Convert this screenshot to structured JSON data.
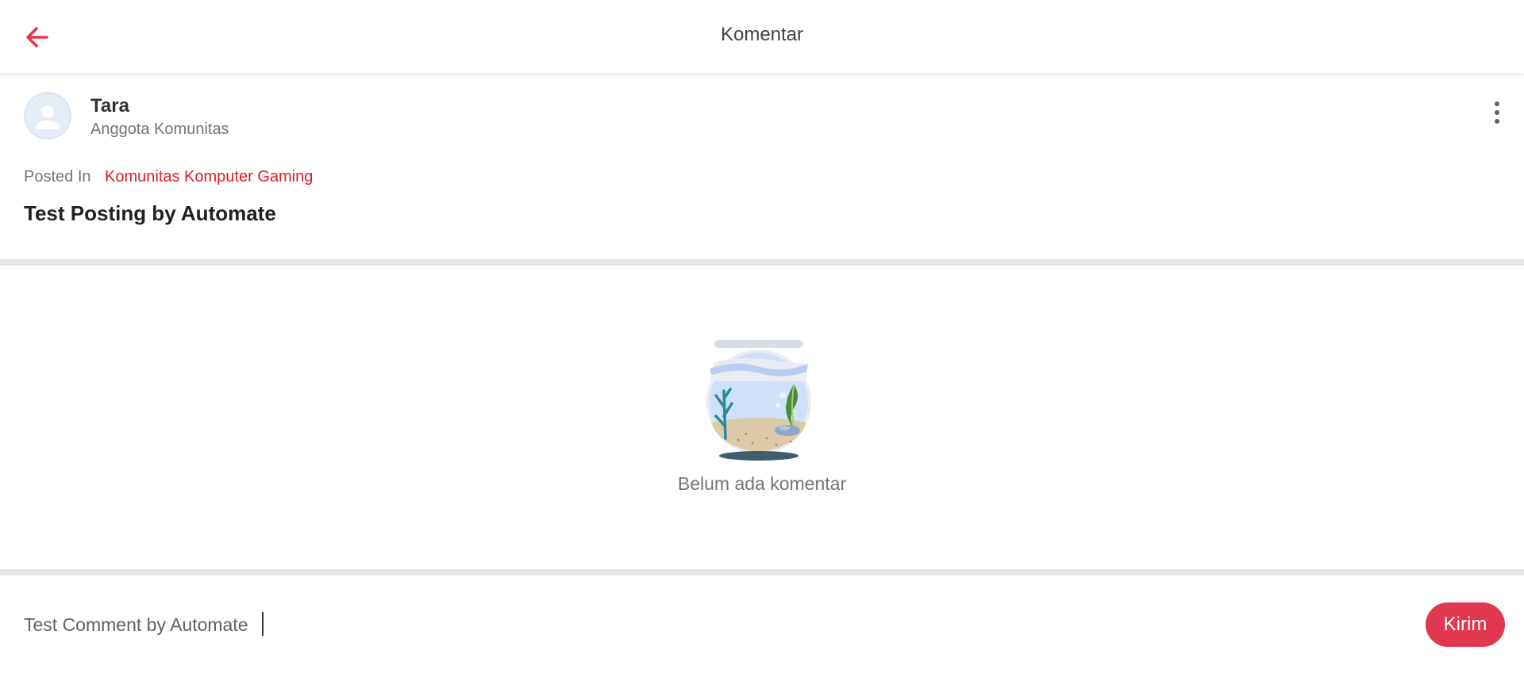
{
  "header": {
    "title": "Komentar",
    "back_icon": "arrow-left-icon"
  },
  "post": {
    "author": {
      "name": "Tara",
      "role": "Anggota Komunitas",
      "avatar_icon": "user-avatar-icon"
    },
    "more_icon": "more-vertical-icon",
    "posted_in_label": "Posted In",
    "community": "Komunitas Komputer Gaming",
    "title": "Test Posting by Automate"
  },
  "comments": {
    "empty_illustration": "fishbowl-illustration",
    "empty_text": "Belum ada komentar"
  },
  "composer": {
    "value": "Test Comment by Automate",
    "send_label": "Kirim"
  },
  "colors": {
    "accent": "#e2384f",
    "link": "#d81f26"
  }
}
